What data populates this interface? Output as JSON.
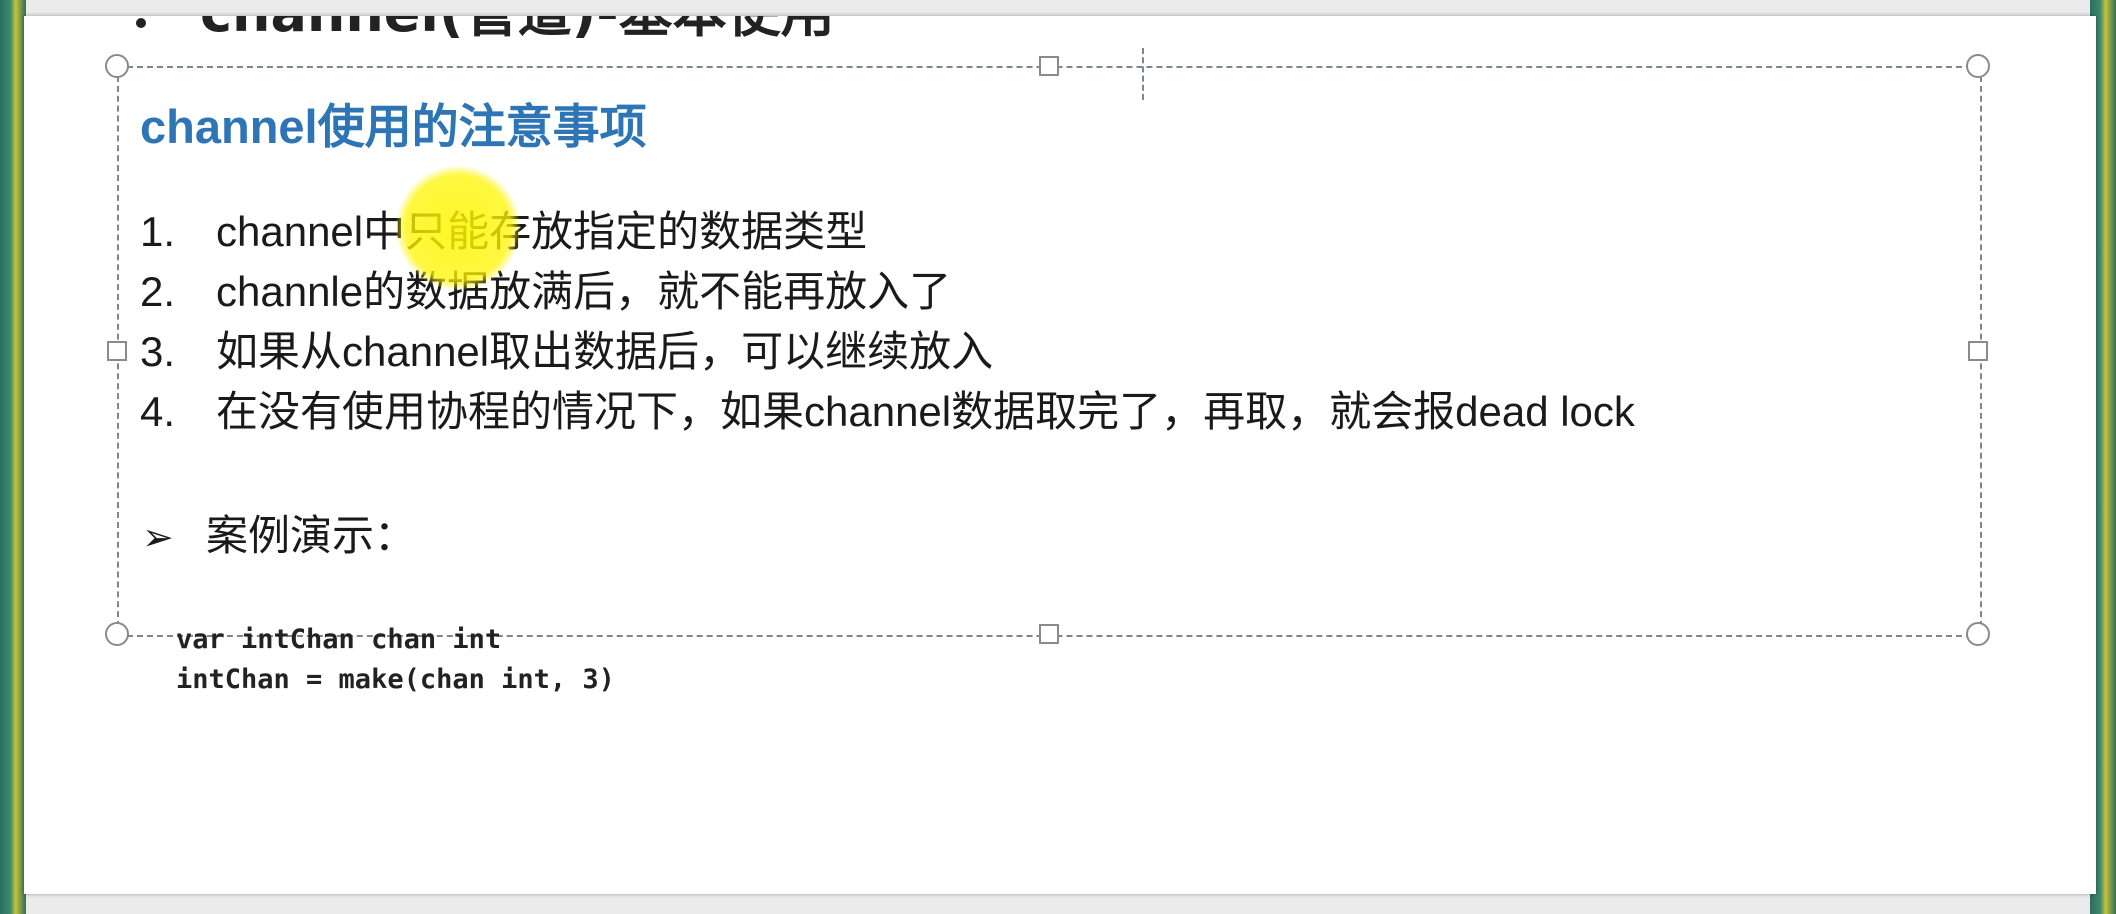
{
  "slide": {
    "cut_title": "channel(管道)-基本使用",
    "heading": "channel使用的注意事项",
    "list_items": [
      {
        "num": "1.",
        "text": "channel中只能存放指定的数据类型"
      },
      {
        "num": "2.",
        "text": "channle的数据放满后，就不能再放入了"
      },
      {
        "num": "3.",
        "text": "如果从channel取出数据后，可以继续放入"
      },
      {
        "num": "4.",
        "text": "在没有使用协程的情况下，如果channel数据取完了，再取，就会报dead lock"
      }
    ],
    "example_arrow": "➢",
    "example_label": "案例演示：",
    "code_lines": [
      "var intChan chan int",
      "intChan = make(chan int, 3)"
    ]
  },
  "colors": {
    "heading": "#2e75b6",
    "highlight": "#fff500",
    "selection_border": "#7b8794"
  },
  "icons": {
    "bullet": "arrow-bullet-icon",
    "cursor_highlight": "cursor-highlight-icon"
  }
}
